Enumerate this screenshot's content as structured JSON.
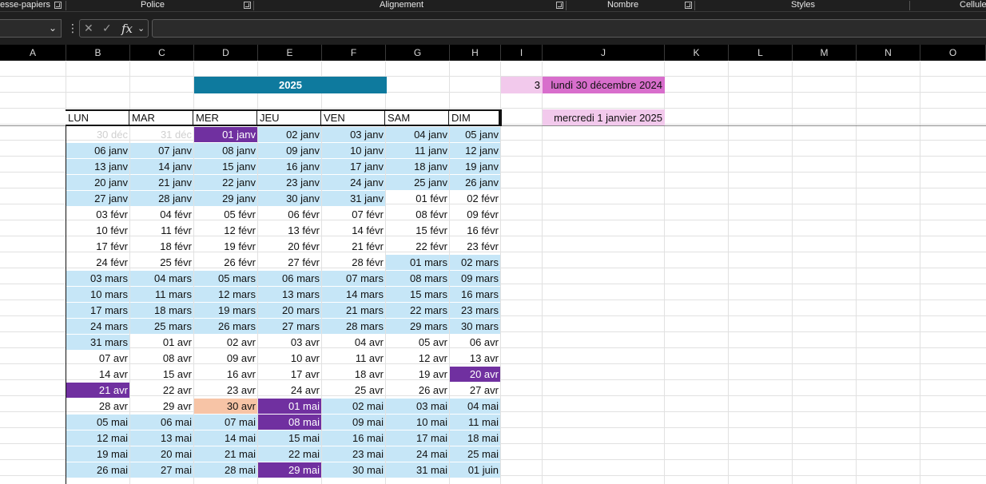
{
  "ribbon": {
    "groups": [
      "esse-papiers",
      "Police",
      "Alignement",
      "Nombre",
      "Styles",
      "Cellule"
    ]
  },
  "formula_bar": {
    "name_box": "",
    "formula": "",
    "fx_label": "fx",
    "cancel_icon": "close-icon",
    "enter_icon": "check-icon"
  },
  "columns": [
    "A",
    "B",
    "C",
    "D",
    "E",
    "F",
    "G",
    "H",
    "I",
    "J",
    "K",
    "L",
    "M",
    "N",
    "O"
  ],
  "sheet": {
    "year": "2025",
    "index_value": "3",
    "date_long_1": "lundi 30 décembre 2024",
    "date_long_2": "mercredi 1 janvier 2025",
    "weekday_headers": [
      "LUN",
      "MAR",
      "MER",
      "JEU",
      "VEN",
      "SAM",
      "DIM"
    ],
    "rows": [
      [
        "30 déc",
        "31 déc",
        "01 janv",
        "02 janv",
        "03 janv",
        "04 janv",
        "05 janv"
      ],
      [
        "06 janv",
        "07 janv",
        "08 janv",
        "09 janv",
        "10 janv",
        "11 janv",
        "12 janv"
      ],
      [
        "13 janv",
        "14 janv",
        "15 janv",
        "16 janv",
        "17 janv",
        "18 janv",
        "19 janv"
      ],
      [
        "20 janv",
        "21 janv",
        "22 janv",
        "23 janv",
        "24 janv",
        "25 janv",
        "26 janv"
      ],
      [
        "27 janv",
        "28 janv",
        "29 janv",
        "30 janv",
        "31 janv",
        "01 févr",
        "02 févr"
      ],
      [
        "03 févr",
        "04 févr",
        "05 févr",
        "06 févr",
        "07 févr",
        "08 févr",
        "09 févr"
      ],
      [
        "10 févr",
        "11 févr",
        "12 févr",
        "13 févr",
        "14 févr",
        "15 févr",
        "16 févr"
      ],
      [
        "17 févr",
        "18 févr",
        "19 févr",
        "20 févr",
        "21 févr",
        "22 févr",
        "23 févr"
      ],
      [
        "24 févr",
        "25 févr",
        "26 févr",
        "27 févr",
        "28 févr",
        "01 mars",
        "02 mars"
      ],
      [
        "03 mars",
        "04 mars",
        "05 mars",
        "06 mars",
        "07 mars",
        "08 mars",
        "09 mars"
      ],
      [
        "10 mars",
        "11 mars",
        "12 mars",
        "13 mars",
        "14 mars",
        "15 mars",
        "16 mars"
      ],
      [
        "17 mars",
        "18 mars",
        "19 mars",
        "20 mars",
        "21 mars",
        "22 mars",
        "23 mars"
      ],
      [
        "24 mars",
        "25 mars",
        "26 mars",
        "27 mars",
        "28 mars",
        "29 mars",
        "30 mars"
      ],
      [
        "31 mars",
        "01 avr",
        "02 avr",
        "03 avr",
        "04 avr",
        "05 avr",
        "06 avr"
      ],
      [
        "07 avr",
        "08 avr",
        "09 avr",
        "10 avr",
        "11 avr",
        "12 avr",
        "13 avr"
      ],
      [
        "14 avr",
        "15 avr",
        "16 avr",
        "17 avr",
        "18 avr",
        "19 avr",
        "20 avr"
      ],
      [
        "21 avr",
        "22 avr",
        "23 avr",
        "24 avr",
        "25 avr",
        "26 avr",
        "27 avr"
      ],
      [
        "28 avr",
        "29 avr",
        "30 avr",
        "01 mai",
        "02 mai",
        "03 mai",
        "04 mai"
      ],
      [
        "05 mai",
        "06 mai",
        "07 mai",
        "08 mai",
        "09 mai",
        "10 mai",
        "11 mai"
      ],
      [
        "12 mai",
        "13 mai",
        "14 mai",
        "15 mai",
        "16 mai",
        "17 mai",
        "18 mai"
      ],
      [
        "19 mai",
        "20 mai",
        "21 mai",
        "22 mai",
        "23 mai",
        "24 mai",
        "25 mai"
      ],
      [
        "26 mai",
        "27 mai",
        "28 mai",
        "29 mai",
        "30 mai",
        "31 mai",
        "01 juin"
      ]
    ],
    "styles": [
      [
        "g",
        "g",
        "p",
        "l",
        "l",
        "l",
        "l"
      ],
      [
        "l",
        "l",
        "l",
        "l",
        "l",
        "l",
        "l"
      ],
      [
        "l",
        "l",
        "l",
        "l",
        "l",
        "l",
        "l"
      ],
      [
        "l",
        "l",
        "l",
        "l",
        "l",
        "l",
        "l"
      ],
      [
        "l",
        "l",
        "l",
        "l",
        "l",
        "w",
        "w"
      ],
      [
        "w",
        "w",
        "w",
        "w",
        "w",
        "w",
        "w"
      ],
      [
        "w",
        "w",
        "w",
        "w",
        "w",
        "w",
        "w"
      ],
      [
        "w",
        "w",
        "w",
        "w",
        "w",
        "w",
        "w"
      ],
      [
        "w",
        "w",
        "w",
        "w",
        "w",
        "l",
        "l"
      ],
      [
        "l",
        "l",
        "l",
        "l",
        "l",
        "l",
        "l"
      ],
      [
        "l",
        "l",
        "l",
        "l",
        "l",
        "l",
        "l"
      ],
      [
        "l",
        "l",
        "l",
        "l",
        "l",
        "l",
        "l"
      ],
      [
        "l",
        "l",
        "l",
        "l",
        "l",
        "l",
        "l"
      ],
      [
        "l",
        "w",
        "w",
        "w",
        "w",
        "w",
        "w"
      ],
      [
        "w",
        "w",
        "w",
        "w",
        "w",
        "w",
        "w"
      ],
      [
        "w",
        "w",
        "w",
        "w",
        "w",
        "w",
        "p"
      ],
      [
        "p",
        "w",
        "w",
        "w",
        "w",
        "w",
        "w"
      ],
      [
        "w",
        "w",
        "o",
        "p",
        "l",
        "l",
        "l"
      ],
      [
        "l",
        "l",
        "l",
        "p",
        "l",
        "l",
        "l"
      ],
      [
        "l",
        "l",
        "l",
        "l",
        "l",
        "l",
        "l"
      ],
      [
        "l",
        "l",
        "l",
        "l",
        "l",
        "l",
        "l"
      ],
      [
        "l",
        "l",
        "l",
        "p",
        "l",
        "l",
        "l"
      ]
    ],
    "colors": {
      "light_blue": "#c6e6f7",
      "purple": "#7030a0",
      "peach": "#f7c4a6",
      "year_teal": "#0e7a9e",
      "pink_light": "#f2c9ec",
      "pink": "#d86ecc"
    }
  }
}
